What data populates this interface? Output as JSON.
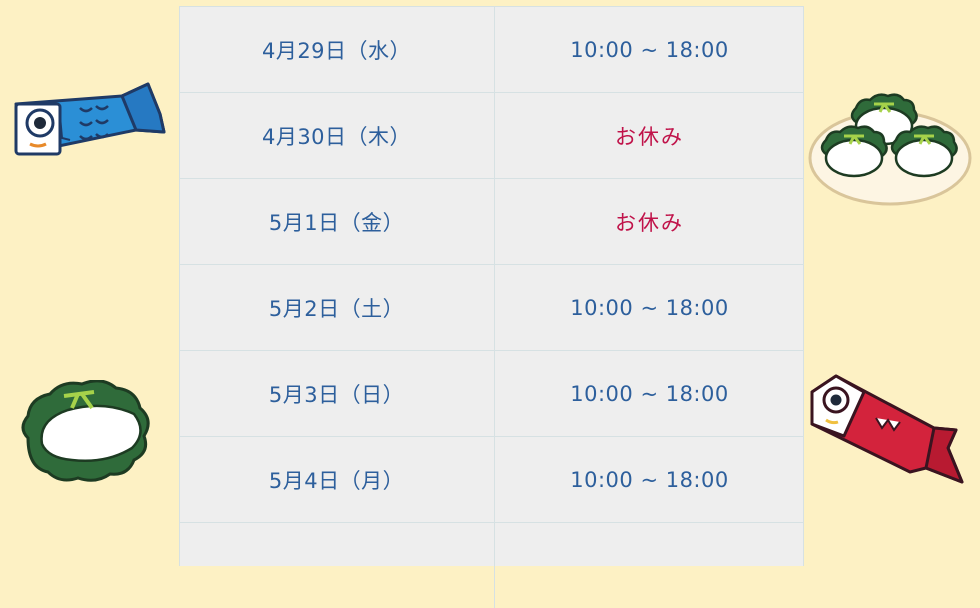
{
  "schedule": {
    "rows": [
      {
        "date": "4月29日（水）",
        "hours": "10:00 ~ 18:00",
        "closed": false
      },
      {
        "date": "4月30日（木）",
        "hours": "お休み",
        "closed": true
      },
      {
        "date": "5月1日（金）",
        "hours": "お休み",
        "closed": true
      },
      {
        "date": "5月2日（土）",
        "hours": "10:00 ~ 18:00",
        "closed": false
      },
      {
        "date": "5月3日（日）",
        "hours": "10:00 ~ 18:00",
        "closed": false
      },
      {
        "date": "5月4日（月）",
        "hours": "10:00 ~ 18:00",
        "closed": false
      },
      {
        "date": "",
        "hours": "",
        "closed": false
      }
    ]
  },
  "decorations": {
    "blue_koinobori": {
      "icon": "koinobori-blue-icon",
      "color": "#2b8fd6"
    },
    "red_koinobori": {
      "icon": "koinobori-red-icon",
      "color": "#d3233c"
    },
    "kashiwa_mochi_plate": {
      "icon": "kashiwa-mochi-plate-icon",
      "color": "#2f6b3a"
    },
    "kashiwa_mochi_single": {
      "icon": "kashiwa-mochi-icon",
      "color": "#2f6b3a"
    }
  },
  "colors": {
    "background": "#fdf1c4",
    "table": "#eeeeee",
    "open_text": "#2d5f9c",
    "closed_text": "#c0134a"
  }
}
